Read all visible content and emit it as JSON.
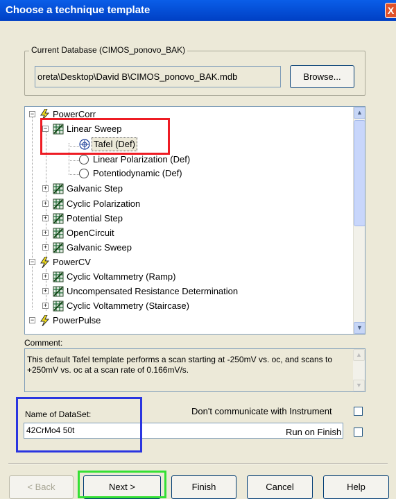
{
  "window": {
    "title": "Choose a technique template",
    "close_glyph": "X"
  },
  "database": {
    "group_label": "Current Database (CIMOS_ponovo_BAK)",
    "path_value": "oreta\\Desktop\\David B\\CIMOS_ponovo_BAK.mdb",
    "browse_label": "Browse..."
  },
  "tree": {
    "items": [
      {
        "label": "PowerCorr"
      },
      {
        "label": "Linear Sweep"
      },
      {
        "label": "Tafel (Def)"
      },
      {
        "label": "Linear Polarization (Def)"
      },
      {
        "label": "Potentiodynamic (Def)"
      },
      {
        "label": "Galvanic Step"
      },
      {
        "label": "Cyclic Polarization"
      },
      {
        "label": "Potential Step"
      },
      {
        "label": "OpenCircuit"
      },
      {
        "label": "Galvanic Sweep"
      },
      {
        "label": "PowerCV"
      },
      {
        "label": "Cyclic Voltammetry (Ramp)"
      },
      {
        "label": "Uncompensated Resistance Determination"
      },
      {
        "label": "Cyclic Voltammetry (Staircase)"
      },
      {
        "label": "PowerPulse"
      }
    ],
    "selected_label": "Tafel (Def)"
  },
  "comment": {
    "label": "Comment:",
    "text": "This default Tafel template performs a scan starting at -250mV vs. oc, and scans to +250mV vs. oc at a scan rate of 0.166mV/s."
  },
  "dataset": {
    "label": "Name of DataSet:",
    "value": "42CrMo4 50t",
    "dont_communicate_label": "Don't communicate with Instrument",
    "run_on_finish_label": "Run on Finish"
  },
  "buttons": {
    "back": "< Back",
    "next": "Next >",
    "finish": "Finish",
    "cancel": "Cancel",
    "help": "Help"
  },
  "colors": {
    "title_bar": "#0550d8",
    "dialog_bg": "#ece9d8",
    "highlight_red": "#ee1c24",
    "highlight_blue": "#2a35e0",
    "highlight_green": "#35e034"
  }
}
